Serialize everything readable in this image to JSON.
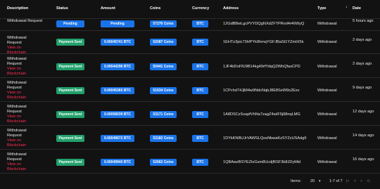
{
  "table": {
    "headers": {
      "description": "Description",
      "status": "Status",
      "amount": "Amount",
      "coins": "Coins",
      "currency": "Currency",
      "address": "Address",
      "type": "Type",
      "date": "Date"
    },
    "sort_icon": "↓",
    "rows": [
      {
        "desc": "Withdrawal Request",
        "link": "",
        "status": "Pending",
        "amount": "Pending",
        "coins": "57276 Coins",
        "currency": "BTC",
        "address": "12GdBBwLgcPVYDQgNXdZFTPRvd4r46WyQ",
        "type": "Withdrawal",
        "date": "5 hours ago"
      },
      {
        "desc": "Withdrawal Request",
        "link": "View on Blockchain",
        "status": "Payment Sent",
        "amount": "0.00045741 BTC",
        "coins": "52087 Coins",
        "currency": "BTC",
        "address": "1EHTz3pic73HPYk9hmqYGFJBaSt1YZmtX5k",
        "type": "Withdrawal",
        "date": "2 days ago"
      },
      {
        "desc": "Withdrawal Request",
        "link": "View on Blockchain",
        "status": "Payment Sent",
        "amount": "0.00044296 BTC",
        "coins": "50441 Coins",
        "currency": "BTC",
        "address": "1JF4bDoFfU9B14kg49rfYdqQ2WhQfasCPD",
        "type": "Withdrawal",
        "date": "2 days ago"
      },
      {
        "desc": "Withdrawal Request",
        "link": "View on Blockchain",
        "status": "Payment Sent",
        "amount": "0.00045365 BTC",
        "coins": "51634 Coins",
        "currency": "BTC",
        "address": "1CPchd74JjM4w9NdcNqbJ8E8SeW9s2Esv",
        "type": "Withdrawal",
        "date": "9 days ago"
      },
      {
        "desc": "Withdrawal Request",
        "link": "View on Blockchain",
        "status": "Payment Sent",
        "amount": "0.00058039 BTC",
        "coins": "53171 Coins",
        "currency": "BTC",
        "address": "1A8DSCzSxapfVhNa7zagZ4sdF5j68nqLMG",
        "type": "Withdrawal",
        "date": "12 days ago"
      },
      {
        "desc": "Withdrawal Request",
        "link": "View on Blockchain",
        "status": "Payment Sent",
        "amount": "0.00049672 BTC",
        "coins": "53182 Coins",
        "currency": "BTC",
        "address": "1DYkKNBUJrVAWSLQosNbwaKzSYZzUSAdg6",
        "type": "Withdrawal",
        "date": "14 days ago"
      },
      {
        "desc": "Withdrawal Request",
        "link": "View on Blockchain",
        "status": "Payment Sent",
        "amount": "0.00049940 BTC",
        "coins": "52662 Coins",
        "currency": "BTC",
        "address": "1QBAwzBSYEZtxGsm8Ucdjf6SF3b8JDyMid",
        "type": "Withdrawal",
        "date": "16 days ago"
      }
    ]
  },
  "footer": {
    "items_label": "Items:",
    "items_per_page": "20",
    "range": "1-7 of 7",
    "first_icon": "|<",
    "prev_icon": "<",
    "next_icon": ">",
    "last_icon": ">|"
  },
  "colors": {
    "background": "#121212",
    "pending_badge": "#1a73e8",
    "sent_badge": "#22a06b",
    "link": "#ff2e58"
  }
}
